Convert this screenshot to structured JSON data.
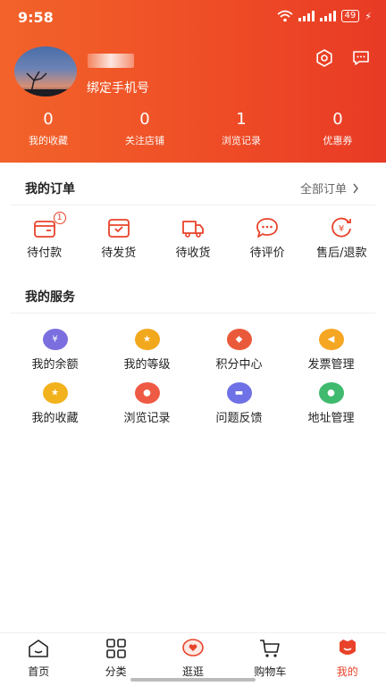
{
  "status_bar": {
    "time": "9:58",
    "battery": "49"
  },
  "profile": {
    "bind_phone": "绑定手机号"
  },
  "stats": [
    {
      "value": "0",
      "label": "我的收藏"
    },
    {
      "value": "0",
      "label": "关注店铺"
    },
    {
      "value": "1",
      "label": "浏览记录"
    },
    {
      "value": "0",
      "label": "优惠券"
    }
  ],
  "orders": {
    "title": "我的订单",
    "all_label": "全部订单",
    "items": [
      {
        "label": "待付款",
        "badge": "1",
        "icon": "wallet-icon"
      },
      {
        "label": "待发货",
        "icon": "package-icon"
      },
      {
        "label": "待收货",
        "icon": "truck-icon"
      },
      {
        "label": "待评价",
        "icon": "comment-icon"
      },
      {
        "label": "售后/退款",
        "icon": "refund-icon"
      }
    ]
  },
  "services": {
    "title": "我的服务",
    "items": [
      {
        "label": "我的余额",
        "icon": "balance-icon",
        "color": "#7b6fe0"
      },
      {
        "label": "我的等级",
        "icon": "level-icon",
        "color": "#f2a81d"
      },
      {
        "label": "积分中心",
        "icon": "points-icon",
        "color": "#ea5a3a"
      },
      {
        "label": "发票管理",
        "icon": "invoice-icon",
        "color": "#f5a623"
      },
      {
        "label": "我的收藏",
        "icon": "favorite-icon",
        "color": "#f2b21d"
      },
      {
        "label": "浏览记录",
        "icon": "history-icon",
        "color": "#ef5a44"
      },
      {
        "label": "问题反馈",
        "icon": "feedback-icon",
        "color": "#6f71e6"
      },
      {
        "label": "地址管理",
        "icon": "address-icon",
        "color": "#3fba6e"
      }
    ]
  },
  "tabs": [
    {
      "label": "首页",
      "icon": "home-icon"
    },
    {
      "label": "分类",
      "icon": "grid-icon"
    },
    {
      "label": "逛逛",
      "icon": "heart-chat-icon"
    },
    {
      "label": "购物车",
      "icon": "cart-icon"
    },
    {
      "label": "我的",
      "icon": "profile-icon",
      "active": true
    }
  ],
  "colors": {
    "accent": "#e8432a",
    "header_start": "#f2632a",
    "header_end": "#e83a25"
  }
}
